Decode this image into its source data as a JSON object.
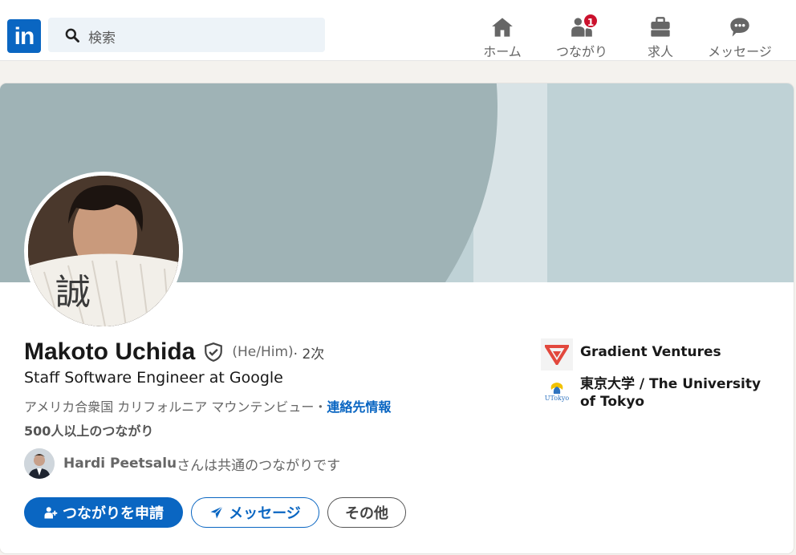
{
  "nav": {
    "logo_text": "in",
    "search_placeholder": "検索",
    "items": [
      {
        "label": "ホーム",
        "icon": "home-icon"
      },
      {
        "label": "つながり",
        "icon": "network-icon",
        "badge": "1"
      },
      {
        "label": "求人",
        "icon": "briefcase-icon"
      },
      {
        "label": "メッセージ",
        "icon": "messaging-icon"
      }
    ]
  },
  "profile": {
    "name": "Makoto Uchida",
    "pronouns": "(He/Him)",
    "degree": " · 2次",
    "headline": "Staff Software Engineer at Google",
    "location": "アメリカ合衆国 カリフォルニア マウンテンビュー・",
    "contact_info": "連絡先情報",
    "connections": "500人以上のつながり",
    "mutual": {
      "name": "Hardi Peetsalu",
      "text": "さんは共通のつながりです"
    },
    "avatar_calligraphy": "誠",
    "actions": {
      "connect": "つながりを申請",
      "message": "メッセージ",
      "more": "その他"
    },
    "orgs": [
      {
        "name": "Gradient Ventures",
        "logo": "gradient-ventures-logo"
      },
      {
        "name": "東京大学 / The University of Tokyo",
        "logo": "utokyo-logo",
        "logo_text": "UTokyo"
      }
    ]
  },
  "colors": {
    "brand": "#0a66c2",
    "badge": "#cb112d",
    "banner_dark": "#9fb3b6",
    "banner_light": "#bfd2d6"
  }
}
